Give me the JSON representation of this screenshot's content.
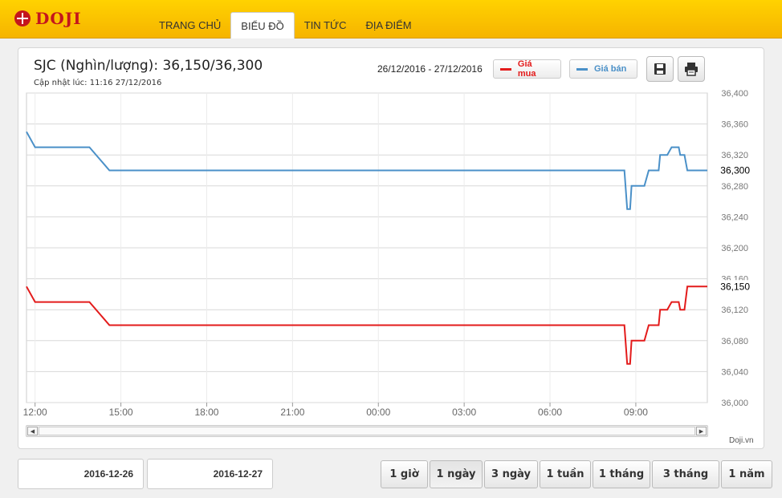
{
  "brand": {
    "name": "DOJI"
  },
  "nav": {
    "items": [
      {
        "label": "TRANG CHỦ"
      },
      {
        "label": "BIỂU ĐỒ"
      },
      {
        "label": "TIN TỨC"
      },
      {
        "label": "ĐỊA ĐIỂM"
      }
    ],
    "active_index": 1
  },
  "header": {
    "title": "SJC (Nghìn/lượng): 36,150/36,300",
    "updated": "Cập nhật lúc: 11:16 27/12/2016",
    "date_range": "26/12/2016 - 27/12/2016"
  },
  "legend": {
    "buy": "Giá mua",
    "sell": "Giá bán"
  },
  "toolbar": {
    "save_icon": "save-icon",
    "print_icon": "print-icon"
  },
  "credit": "Doji.vn",
  "date_inputs": {
    "from": "2016-12-26",
    "to": "2016-12-27"
  },
  "periods": {
    "items": [
      "1 giờ",
      "1 ngày",
      "3 ngày",
      "1 tuần",
      "1 tháng",
      "3 tháng",
      "1 năm"
    ],
    "active_index": 1
  },
  "colors": {
    "buy": "#e31b1b",
    "sell": "#4a90c8",
    "accent": "#f6b400",
    "brand": "#c4161c"
  },
  "chart_data": {
    "type": "line",
    "ylim": [
      36000,
      36400
    ],
    "y_ticks": [
      "36,000",
      "36,040",
      "36,080",
      "36,120",
      "36,160",
      "36,200",
      "36,240",
      "36,280",
      "36,320",
      "36,360",
      "36,400"
    ],
    "x_tick_labels": [
      "12:00",
      "15:00",
      "18:00",
      "21:00",
      "00:00",
      "03:00",
      "06:00",
      "09:00"
    ],
    "x_unit": "hours since 2016-12-26 00:00",
    "xlim": [
      35.7,
      59.5
    ],
    "x_tick_values": [
      36,
      39,
      42,
      45,
      48,
      51,
      54,
      57
    ],
    "current_labels": {
      "sell": "36,300",
      "buy": "36,150"
    },
    "series": [
      {
        "name": "Giá bán",
        "color": "#4a90c8",
        "points": [
          [
            35.7,
            36350
          ],
          [
            36.0,
            36330
          ],
          [
            37.9,
            36330
          ],
          [
            38.6,
            36300
          ],
          [
            56.6,
            36300
          ],
          [
            56.7,
            36250
          ],
          [
            56.8,
            36250
          ],
          [
            56.85,
            36280
          ],
          [
            57.3,
            36280
          ],
          [
            57.45,
            36300
          ],
          [
            57.8,
            36300
          ],
          [
            57.85,
            36320
          ],
          [
            58.1,
            36320
          ],
          [
            58.25,
            36330
          ],
          [
            58.5,
            36330
          ],
          [
            58.55,
            36320
          ],
          [
            58.7,
            36320
          ],
          [
            58.8,
            36300
          ],
          [
            59.5,
            36300
          ]
        ]
      },
      {
        "name": "Giá mua",
        "color": "#e31b1b",
        "points": [
          [
            35.7,
            36150
          ],
          [
            36.0,
            36130
          ],
          [
            37.9,
            36130
          ],
          [
            38.6,
            36100
          ],
          [
            56.6,
            36100
          ],
          [
            56.7,
            36050
          ],
          [
            56.8,
            36050
          ],
          [
            56.85,
            36080
          ],
          [
            57.3,
            36080
          ],
          [
            57.45,
            36100
          ],
          [
            57.8,
            36100
          ],
          [
            57.85,
            36120
          ],
          [
            58.1,
            36120
          ],
          [
            58.25,
            36130
          ],
          [
            58.5,
            36130
          ],
          [
            58.55,
            36120
          ],
          [
            58.7,
            36120
          ],
          [
            58.8,
            36150
          ],
          [
            59.5,
            36150
          ]
        ]
      }
    ]
  }
}
